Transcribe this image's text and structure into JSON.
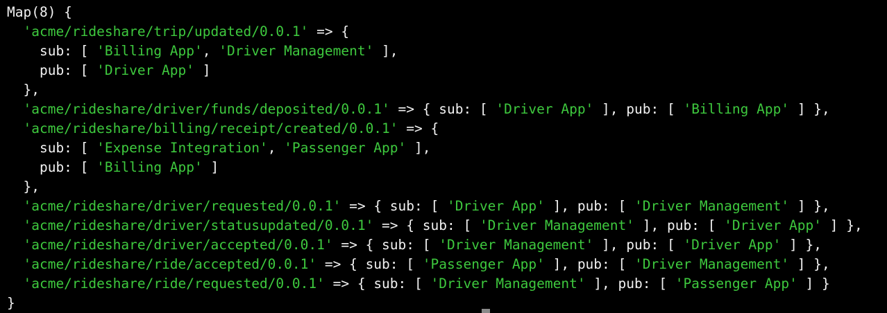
{
  "terminal": {
    "colors": {
      "background": "#000000",
      "text": "#f2f2f2",
      "string": "#3ec93e"
    },
    "lines": [
      [
        {
          "t": "Map(8) {",
          "c": "txt"
        }
      ],
      [
        {
          "t": "  ",
          "c": "txt"
        },
        {
          "t": "'acme/rideshare/trip/updated/0.0.1'",
          "c": "str"
        },
        {
          "t": " => {",
          "c": "txt"
        }
      ],
      [
        {
          "t": "    sub: [ ",
          "c": "txt"
        },
        {
          "t": "'Billing App'",
          "c": "str"
        },
        {
          "t": ", ",
          "c": "txt"
        },
        {
          "t": "'Driver Management'",
          "c": "str"
        },
        {
          "t": " ],",
          "c": "txt"
        }
      ],
      [
        {
          "t": "    pub: [ ",
          "c": "txt"
        },
        {
          "t": "'Driver App'",
          "c": "str"
        },
        {
          "t": " ]",
          "c": "txt"
        }
      ],
      [
        {
          "t": "  },",
          "c": "txt"
        }
      ],
      [
        {
          "t": "  ",
          "c": "txt"
        },
        {
          "t": "'acme/rideshare/driver/funds/deposited/0.0.1'",
          "c": "str"
        },
        {
          "t": " => { sub: [ ",
          "c": "txt"
        },
        {
          "t": "'Driver App'",
          "c": "str"
        },
        {
          "t": " ], pub: [ ",
          "c": "txt"
        },
        {
          "t": "'Billing App'",
          "c": "str"
        },
        {
          "t": " ] },",
          "c": "txt"
        }
      ],
      [
        {
          "t": "  ",
          "c": "txt"
        },
        {
          "t": "'acme/rideshare/billing/receipt/created/0.0.1'",
          "c": "str"
        },
        {
          "t": " => {",
          "c": "txt"
        }
      ],
      [
        {
          "t": "    sub: [ ",
          "c": "txt"
        },
        {
          "t": "'Expense Integration'",
          "c": "str"
        },
        {
          "t": ", ",
          "c": "txt"
        },
        {
          "t": "'Passenger App'",
          "c": "str"
        },
        {
          "t": " ],",
          "c": "txt"
        }
      ],
      [
        {
          "t": "    pub: [ ",
          "c": "txt"
        },
        {
          "t": "'Billing App'",
          "c": "str"
        },
        {
          "t": " ]",
          "c": "txt"
        }
      ],
      [
        {
          "t": "  },",
          "c": "txt"
        }
      ],
      [
        {
          "t": "  ",
          "c": "txt"
        },
        {
          "t": "'acme/rideshare/driver/requested/0.0.1'",
          "c": "str"
        },
        {
          "t": " => { sub: [ ",
          "c": "txt"
        },
        {
          "t": "'Driver App'",
          "c": "str"
        },
        {
          "t": " ], pub: [ ",
          "c": "txt"
        },
        {
          "t": "'Driver Management'",
          "c": "str"
        },
        {
          "t": " ] },",
          "c": "txt"
        }
      ],
      [
        {
          "t": "  ",
          "c": "txt"
        },
        {
          "t": "'acme/rideshare/driver/statusupdated/0.0.1'",
          "c": "str"
        },
        {
          "t": " => { sub: [ ",
          "c": "txt"
        },
        {
          "t": "'Driver Management'",
          "c": "str"
        },
        {
          "t": " ], pub: [ ",
          "c": "txt"
        },
        {
          "t": "'Driver App'",
          "c": "str"
        },
        {
          "t": " ] },",
          "c": "txt"
        }
      ],
      [
        {
          "t": "  ",
          "c": "txt"
        },
        {
          "t": "'acme/rideshare/driver/accepted/0.0.1'",
          "c": "str"
        },
        {
          "t": " => { sub: [ ",
          "c": "txt"
        },
        {
          "t": "'Driver Management'",
          "c": "str"
        },
        {
          "t": " ], pub: [ ",
          "c": "txt"
        },
        {
          "t": "'Driver App'",
          "c": "str"
        },
        {
          "t": " ] },",
          "c": "txt"
        }
      ],
      [
        {
          "t": "  ",
          "c": "txt"
        },
        {
          "t": "'acme/rideshare/ride/accepted/0.0.1'",
          "c": "str"
        },
        {
          "t": " => { sub: [ ",
          "c": "txt"
        },
        {
          "t": "'Passenger App'",
          "c": "str"
        },
        {
          "t": " ], pub: [ ",
          "c": "txt"
        },
        {
          "t": "'Driver Management'",
          "c": "str"
        },
        {
          "t": " ] },",
          "c": "txt"
        }
      ],
      [
        {
          "t": "  ",
          "c": "txt"
        },
        {
          "t": "'acme/rideshare/ride/requested/0.0.1'",
          "c": "str"
        },
        {
          "t": " => { sub: [ ",
          "c": "txt"
        },
        {
          "t": "'Driver Management'",
          "c": "str"
        },
        {
          "t": " ], pub: [ ",
          "c": "txt"
        },
        {
          "t": "'Passenger App'",
          "c": "str"
        },
        {
          "t": " ] }",
          "c": "txt"
        }
      ],
      [
        {
          "t": "}",
          "c": "txt"
        }
      ]
    ]
  }
}
